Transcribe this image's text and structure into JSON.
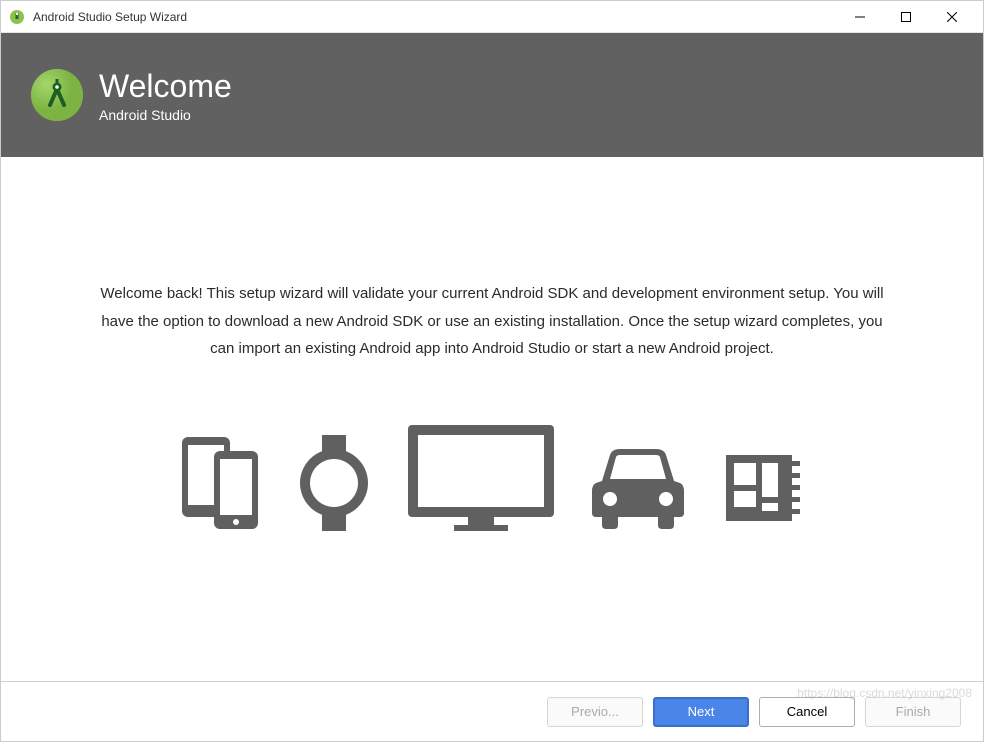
{
  "titlebar": {
    "title": "Android Studio Setup Wizard"
  },
  "header": {
    "title": "Welcome",
    "subtitle": "Android Studio"
  },
  "content": {
    "welcome_text": "Welcome back! This setup wizard will validate your current Android SDK and development environment setup. You will have the option to download a new Android SDK or use an existing installation. Once the setup wizard completes, you can import an existing Android app into Android Studio or start a new Android project."
  },
  "device_icons": [
    "phone-tablet",
    "watch",
    "tv",
    "car",
    "things"
  ],
  "footer": {
    "previous_label": "Previo...",
    "next_label": "Next",
    "cancel_label": "Cancel",
    "finish_label": "Finish"
  },
  "watermark": "https://blog.csdn.net/yinxing2008"
}
